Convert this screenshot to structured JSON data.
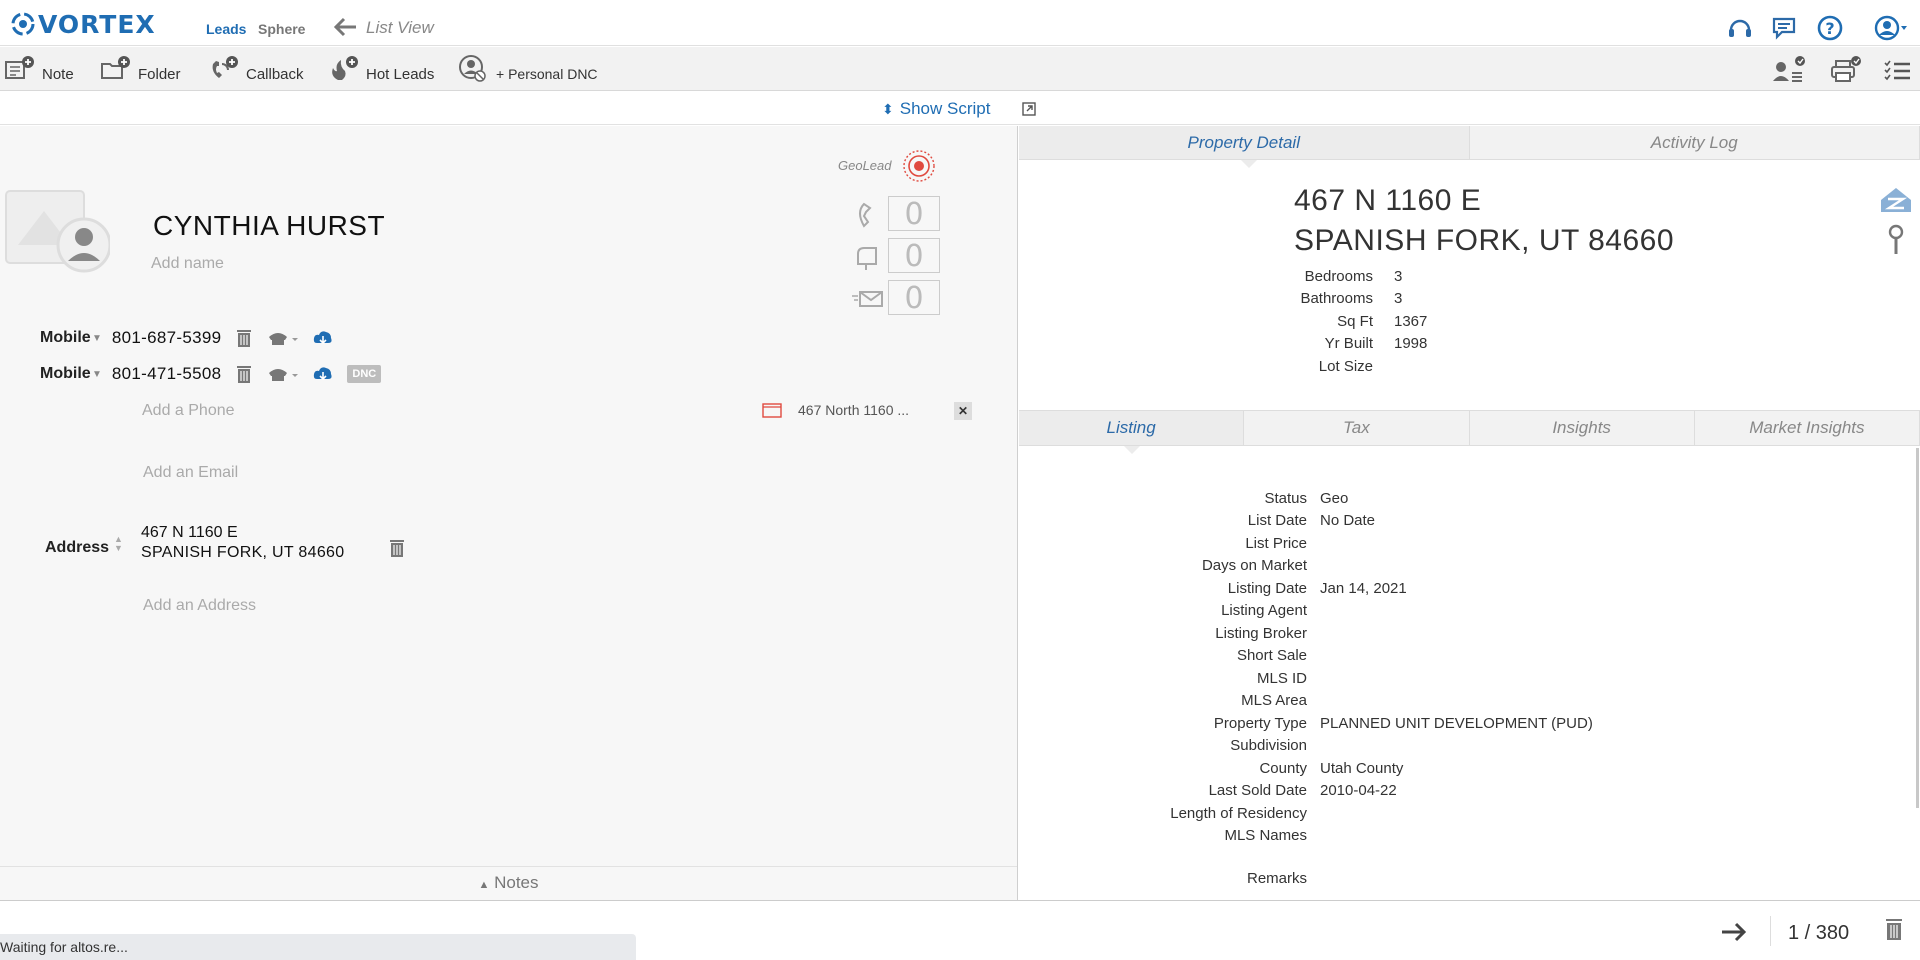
{
  "header": {
    "logo_text": "VORTEX",
    "nav_leads": "Leads",
    "nav_sphere": "Sphere",
    "list_view": "List View"
  },
  "toolbar": {
    "note": "Note",
    "folder": "Folder",
    "callback": "Callback",
    "hot_leads": "Hot Leads",
    "personal_dnc": "+ Personal DNC"
  },
  "script": {
    "label": "Show Script"
  },
  "contact": {
    "name": "CYNTHIA HURST",
    "add_name": "Add name",
    "geolead_label": "GeoLead",
    "counters": {
      "calls": "0",
      "mail": "0",
      "email": "0"
    },
    "phones": [
      {
        "type": "Mobile",
        "number": "801-687-5399",
        "dnc": ""
      },
      {
        "type": "Mobile",
        "number": "801-471-5508",
        "dnc": "DNC"
      }
    ],
    "add_phone": "Add a Phone",
    "add_email": "Add an Email",
    "address_chip": "467 North 1160 ...",
    "address_label": "Address",
    "address_line1": "467 N 1160 E",
    "address_line2": "SPANISH FORK,  UT   84660",
    "add_address": "Add an Address",
    "notes_label": "Notes"
  },
  "property": {
    "tabs": [
      "Property Detail",
      "Activity Log"
    ],
    "address_line1": "467 N 1160 E",
    "address_line2": "SPANISH FORK, UT 84660",
    "details": [
      {
        "k": "Bedrooms",
        "v": "3"
      },
      {
        "k": "Bathrooms",
        "v": "3"
      },
      {
        "k": "Sq Ft",
        "v": "1367"
      },
      {
        "k": "Yr Built",
        "v": "1998"
      },
      {
        "k": "Lot Size",
        "v": ""
      }
    ],
    "subtabs": [
      "Listing",
      "Tax",
      "Insights",
      "Market Insights"
    ],
    "listing": [
      {
        "k": "Status",
        "v": "Geo"
      },
      {
        "k": "List Date",
        "v": "No Date"
      },
      {
        "k": "List Price",
        "v": ""
      },
      {
        "k": "Days on Market",
        "v": ""
      },
      {
        "k": "Listing Date",
        "v": "Jan 14, 2021"
      },
      {
        "k": "Listing Agent",
        "v": ""
      },
      {
        "k": "Listing Broker",
        "v": ""
      },
      {
        "k": "Short Sale",
        "v": ""
      },
      {
        "k": "MLS ID",
        "v": ""
      },
      {
        "k": "MLS Area",
        "v": ""
      },
      {
        "k": "Property Type",
        "v": "PLANNED UNIT DEVELOPMENT (PUD)"
      },
      {
        "k": "Subdivision",
        "v": ""
      },
      {
        "k": "County",
        "v": "Utah County"
      },
      {
        "k": "Last Sold Date",
        "v": "2010-04-22"
      },
      {
        "k": "Length of Residency",
        "v": ""
      },
      {
        "k": "MLS Names",
        "v": ""
      }
    ],
    "remarks_label": "Remarks"
  },
  "pager": {
    "text": "1 / 380"
  },
  "status": {
    "text": "Waiting for altos.re..."
  },
  "colors": {
    "accent": "#1f6db3",
    "tab_active": "#2c6aa8"
  }
}
